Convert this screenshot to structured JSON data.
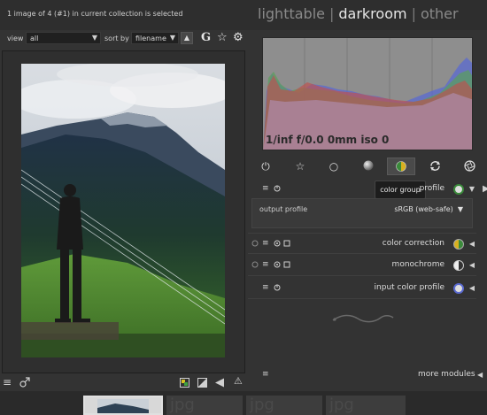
{
  "header": {
    "status": "1 image of 4 (#1) in current collection is selected",
    "views": [
      "lighttable",
      "darkroom",
      "other"
    ],
    "separator": "|",
    "active_view": "darkroom"
  },
  "filterbar": {
    "view_label": "view",
    "view_value": "all",
    "sort_label": "sort by",
    "sort_value": "filename",
    "sort_dir_glyph": "▲",
    "caret": "▼",
    "icons": [
      "google-g-icon",
      "star-icon",
      "gear-icon"
    ],
    "g_glyph": "G"
  },
  "histogram": {
    "exif": "1/inf f/0.0 0mm iso 0",
    "colors": {
      "background": "#8e8e8e",
      "red": "#c0504d",
      "green": "#5aa05a",
      "blue": "#5a6ad0"
    }
  },
  "module_groups": {
    "icons": [
      "power-icon",
      "favorite-star-icon",
      "basic-circle-icon",
      "tone-sphere-icon",
      "color-group-icon",
      "correct-arrows-icon",
      "effect-aperture-icon"
    ],
    "active": "color-group-icon",
    "tooltip": "color group"
  },
  "modules": [
    {
      "name": "output color profile",
      "visible_name": "profile",
      "expanded": true
    },
    {
      "name": "color correction",
      "visible_name": "color correction",
      "expanded": false
    },
    {
      "name": "monochrome",
      "visible_name": "monochrome",
      "expanded": false
    },
    {
      "name": "input color profile",
      "visible_name": "input color profile",
      "expanded": false
    }
  ],
  "output_profile": {
    "label": "output profile",
    "value": "sRGB (web-safe)",
    "caret": "▼"
  },
  "more_modules": "more modules",
  "glyphs": {
    "hamburger": "≡",
    "power": "⏻",
    "star": "☆",
    "circle": "○",
    "arrow_left": "◀",
    "arrow_right": "▶",
    "warning": "⚠",
    "gear": "⚙",
    "swirl": "∿"
  },
  "filmstrip": {
    "thumbs": [
      "jpg",
      "jpg",
      "jpg",
      "jpg"
    ]
  }
}
